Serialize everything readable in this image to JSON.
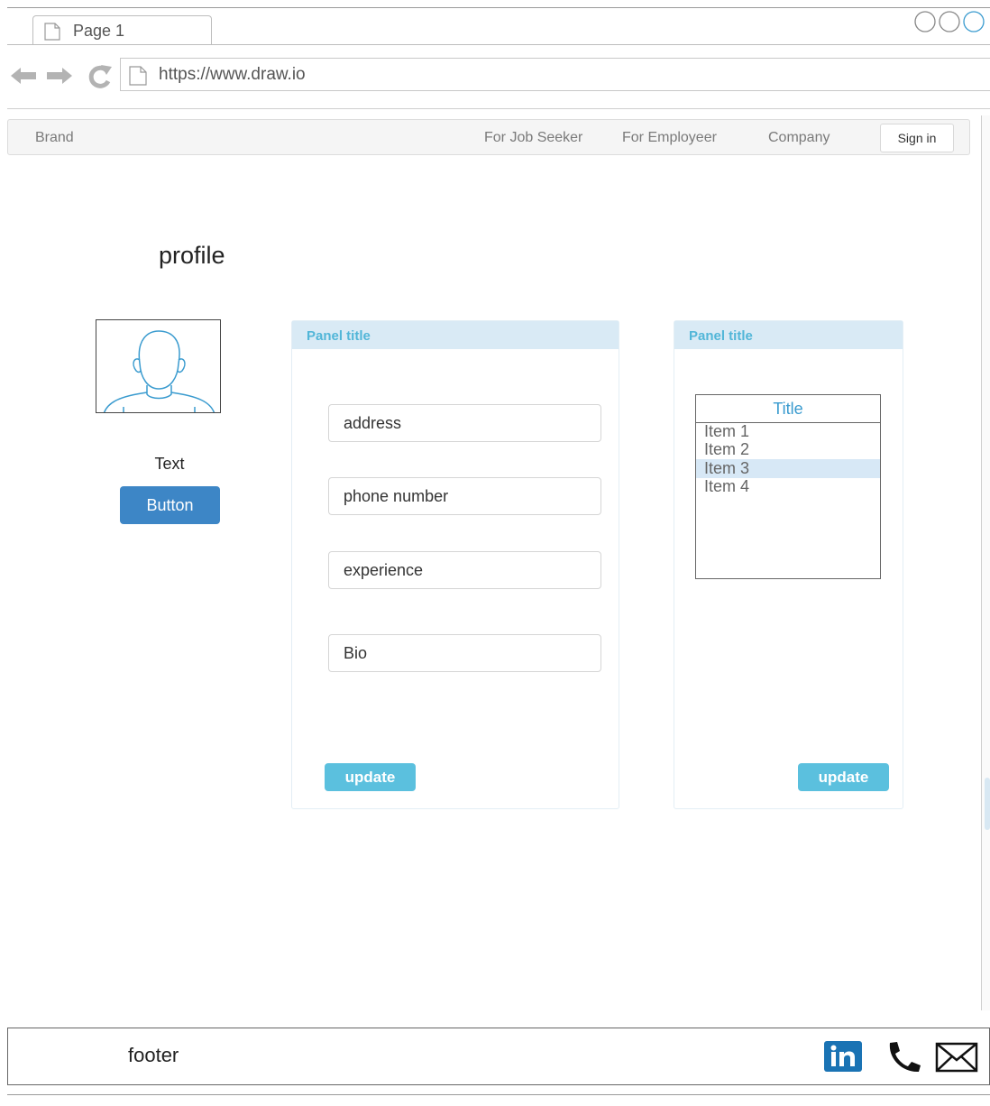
{
  "browser": {
    "tab_label": "Page 1",
    "url": "https://www.draw.io"
  },
  "navbar": {
    "brand": "Brand",
    "links": [
      "For Job Seeker",
      "For Employeer",
      "Company"
    ],
    "signin_label": "Sign in"
  },
  "page": {
    "title": "profile",
    "avatar_text": "Text",
    "avatar_button": "Button"
  },
  "form_panel": {
    "title": "Panel title",
    "fields": [
      "address",
      "phone number",
      "experience",
      "Bio"
    ],
    "update_label": "update"
  },
  "list_panel": {
    "title": "Panel title",
    "list_title": "Title",
    "items": [
      "Item 1",
      "Item 2",
      "Item 3",
      "Item 4"
    ],
    "selected_index": 2,
    "update_label": "update"
  },
  "footer": {
    "text": "footer",
    "icons": [
      "linkedin-icon",
      "phone-icon",
      "mail-icon"
    ]
  },
  "colors": {
    "primary_button": "#3d86c6",
    "update_button": "#5bc0de",
    "panel_header": "#d9eaf5",
    "panel_title": "#52b6d8",
    "linkedin": "#1a73b4"
  }
}
